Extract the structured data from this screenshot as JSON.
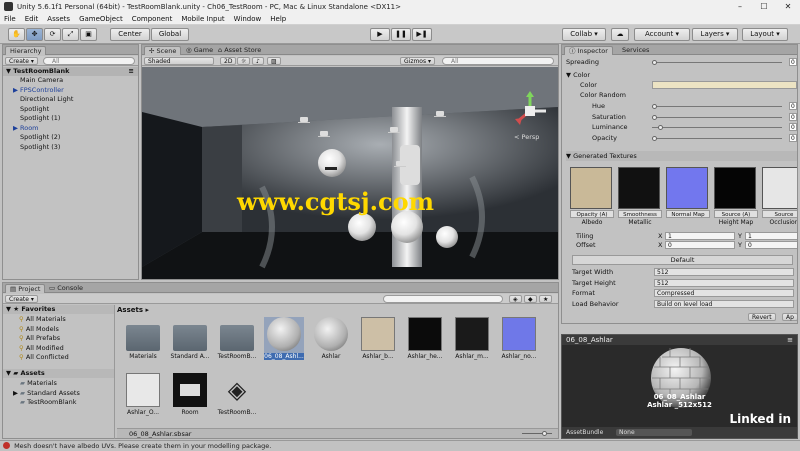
{
  "window": {
    "title": "Unity 5.6.1f1 Personal (64bit) - TestRoomBlank.unity - Ch06_TestRoom - PC, Mac & Linux Standalone <DX11>"
  },
  "menu": [
    "File",
    "Edit",
    "Assets",
    "GameObject",
    "Component",
    "Mobile Input",
    "Window",
    "Help"
  ],
  "toolbar": {
    "center": "Center",
    "global": "Global",
    "collab": "Collab ▾",
    "account": "Account ▾",
    "layers": "Layers ▾",
    "layout": "Layout ▾"
  },
  "hierarchy": {
    "tab": "Hierarchy",
    "create": "Create ▾",
    "search": "All",
    "scene": "TestRoomBlank",
    "items": [
      {
        "label": "Main Camera",
        "prefab": false,
        "arrow": ""
      },
      {
        "label": "FPSController",
        "prefab": true,
        "arrow": "▶"
      },
      {
        "label": "Directional Light",
        "prefab": false,
        "arrow": ""
      },
      {
        "label": "Spotlight",
        "prefab": false,
        "arrow": ""
      },
      {
        "label": "Spotlight (1)",
        "prefab": false,
        "arrow": ""
      },
      {
        "label": "Room",
        "prefab": true,
        "arrow": "▶"
      },
      {
        "label": "Spotlight (2)",
        "prefab": false,
        "arrow": ""
      },
      {
        "label": "Spotlight (3)",
        "prefab": false,
        "arrow": ""
      }
    ]
  },
  "scene": {
    "tabs": [
      "Scene",
      "Game",
      "Asset Store"
    ],
    "shading": "Shaded",
    "mode2d": "2D",
    "gizmos": "Gizmos ▾",
    "search": "All",
    "persp": "< Persp",
    "watermark": "www.cgtsj.com"
  },
  "project": {
    "tabs": [
      "Project",
      "Console"
    ],
    "create": "Create ▾",
    "favorites_label": "Favorites",
    "favorites": [
      "All Materials",
      "All Models",
      "All Prefabs",
      "All Modified",
      "All Conflicted"
    ],
    "assets_label": "Assets",
    "assets_tree": [
      "Materials",
      "Standard Assets",
      "TestRoomBlank"
    ],
    "breadcrumb": "Assets ▸",
    "grid": [
      {
        "label": "Materials",
        "kind": "folder"
      },
      {
        "label": "Standard A...",
        "kind": "folder"
      },
      {
        "label": "TestRoomB...",
        "kind": "folder"
      },
      {
        "label": "06_08_Ashl...",
        "kind": "sphere",
        "selected": true
      },
      {
        "label": "Ashlar",
        "kind": "sphere"
      },
      {
        "label": "Ashlar_b...",
        "kind": "tex",
        "color": "#cdbfa6"
      },
      {
        "label": "Ashlar_he...",
        "kind": "tex",
        "color": "#0b0b0b"
      },
      {
        "label": "Ashlar_m...",
        "kind": "tex",
        "color": "#1a1a1a"
      },
      {
        "label": "Ashlar_no...",
        "kind": "tex",
        "color": "#6f78e8"
      },
      {
        "label": "Ashlar_O...",
        "kind": "tex",
        "color": "#e8e8e8"
      },
      {
        "label": "Room",
        "kind": "room"
      },
      {
        "label": "TestRoomB...",
        "kind": "unity"
      }
    ],
    "footer_path": "06_08_Ashlar.sbsar"
  },
  "inspector": {
    "tabs": [
      "Inspector",
      "Services"
    ],
    "spreading_label": "Spreading",
    "spreading_value": "0",
    "color_label": "Color",
    "color_sub": "Color",
    "color_random": "Color Random",
    "hsl": [
      {
        "label": "Hue",
        "value": "0"
      },
      {
        "label": "Saturation",
        "value": "0"
      },
      {
        "label": "Luminance",
        "value": "0"
      },
      {
        "label": "Opacity",
        "value": "0"
      }
    ],
    "hsl_fill": [
      0.0,
      0.0,
      0.05,
      0.0
    ],
    "generated_label": "Generated Textures",
    "textures": [
      {
        "cap": "Opacity (A)",
        "sub": "Albedo",
        "color": "#c9b998"
      },
      {
        "cap": "Smoothness",
        "sub": "Metallic",
        "color": "#111111"
      },
      {
        "cap": "Normal Map",
        "sub": "",
        "color": "#7277ee"
      },
      {
        "cap": "Source (A)",
        "sub": "Height Map",
        "color": "#050505"
      },
      {
        "cap": "Source",
        "sub": "Occlusion",
        "color": "#e6e6e6"
      }
    ],
    "tiling_label": "Tiling",
    "offset_label": "Offset",
    "tiling": {
      "x": "1",
      "y": "1"
    },
    "offset": {
      "x": "0",
      "y": "0"
    },
    "default_label": "Default",
    "settings": [
      {
        "label": "Target Width",
        "value": "512"
      },
      {
        "label": "Target Height",
        "value": "512"
      },
      {
        "label": "Format",
        "value": "Compressed"
      },
      {
        "label": "Load Behavior",
        "value": "Build on level load"
      }
    ],
    "revert": "Revert",
    "apply": "Ap"
  },
  "preview": {
    "title": "06_08_Ashlar",
    "caption1": "06_08_Ashlar",
    "caption2": "Ashlar _512x512",
    "asset_bundle": "AssetBundle",
    "none": "None",
    "brand": "Linked in"
  },
  "status": {
    "message": "Mesh doesn't have albedo UVs. Please create them in your modelling package."
  }
}
